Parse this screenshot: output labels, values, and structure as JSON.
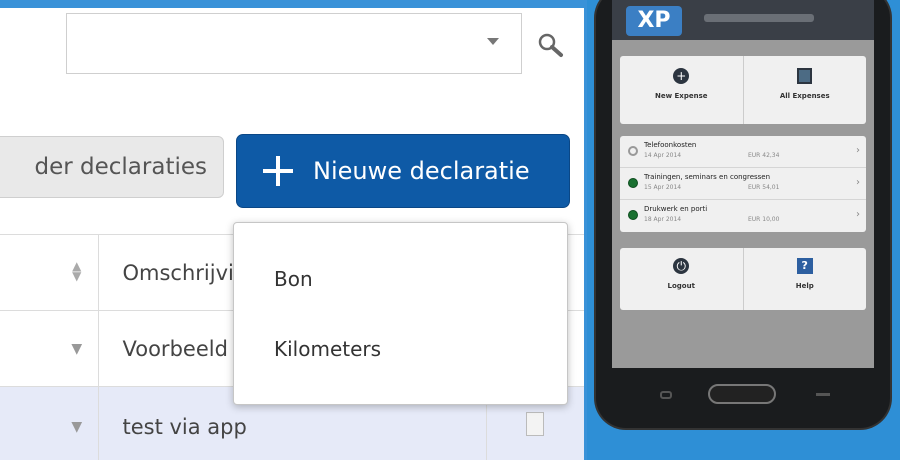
{
  "search": {
    "value": "",
    "placeholder": ""
  },
  "actions": {
    "other_declarations_label": "der declaraties",
    "new_declaration_label": "Nieuwe declaratie"
  },
  "new_declaration_menu": {
    "items": [
      {
        "label": "Bon"
      },
      {
        "label": "Kilometers"
      }
    ]
  },
  "table": {
    "header": {
      "description": "Omschrijving"
    },
    "rows": [
      {
        "description": "Voorbeeld",
        "selected": false
      },
      {
        "description": "test via app",
        "selected": true
      }
    ]
  },
  "phone_app": {
    "logo": "XP",
    "tiles_top": [
      {
        "label": "New Expense",
        "icon": "plus-circle-icon"
      },
      {
        "label": "All Expenses",
        "icon": "list-icon"
      }
    ],
    "expenses": [
      {
        "title": "Telefoonkosten",
        "date": "14 Apr 2014",
        "amount": "EUR 42,34",
        "status": "pending"
      },
      {
        "title": "Trainingen, seminars en congressen",
        "date": "15 Apr 2014",
        "amount": "EUR 54,01",
        "status": "approved"
      },
      {
        "title": "Drukwerk en porti",
        "date": "18 Apr 2014",
        "amount": "EUR 10,00",
        "status": "approved"
      }
    ],
    "tiles_bottom": [
      {
        "label": "Logout",
        "icon": "power-icon"
      },
      {
        "label": "Help",
        "icon": "help-icon"
      }
    ]
  },
  "colors": {
    "background": "#2e8fd6",
    "primary_button": "#0e5aa6",
    "selected_row": "#e6eaf8",
    "approved_status": "#197030"
  }
}
